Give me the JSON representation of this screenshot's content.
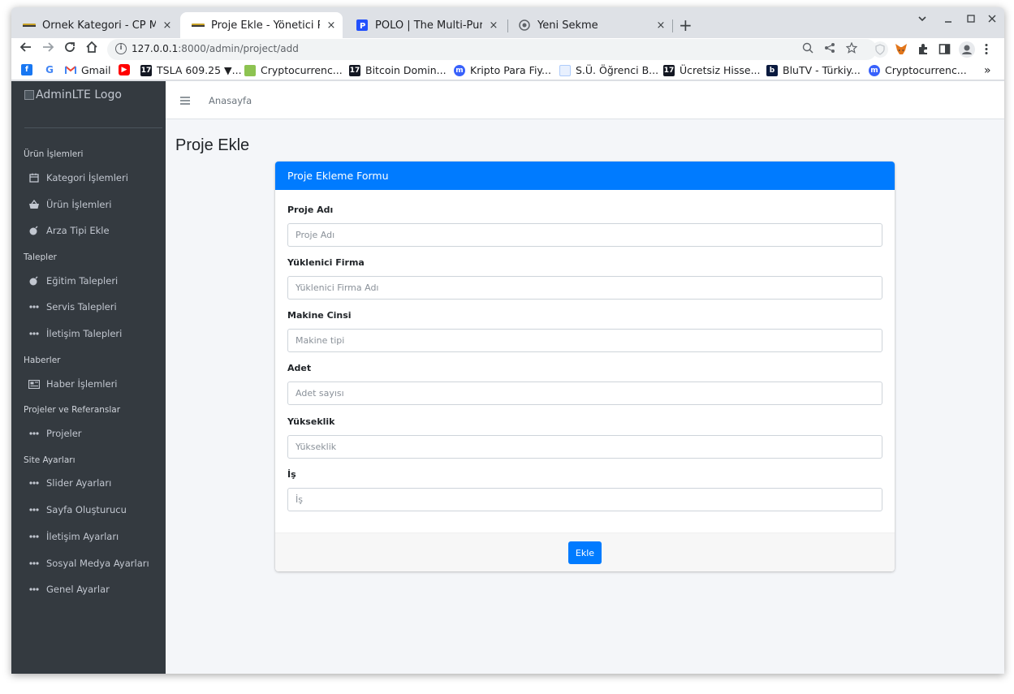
{
  "browser": {
    "tabs": [
      {
        "title": "Örnek Kategori - CP Makin",
        "close": "×"
      },
      {
        "title": "Proje Ekle - Yönetici Panel",
        "close": "×"
      },
      {
        "title": "POLO | The Multi-Purpose",
        "close": "×"
      },
      {
        "title": "Yeni Sekme",
        "close": "×"
      }
    ],
    "url_host": "127.0.0.1",
    "url_rest": ":8000/admin/project/add",
    "bookmarks": [
      "Gmail",
      "TSLA 609.25 ▼...",
      "Cryptocurrenc...",
      "Bitcoin Domin...",
      "Kripto Para Fiy...",
      "S.Ü. Öğrenci B...",
      "Ücretsiz Hisse...",
      "BluTV - Türkiy...",
      "Cryptocurrenc..."
    ],
    "more_bookmarks": "»"
  },
  "sidebar": {
    "brand": "AdminLTE Logo",
    "sections": [
      {
        "header": "Ürün İşlemleri",
        "items": [
          "Kategori İşlemleri",
          "Ürün İşlemleri",
          "Arza Tipi Ekle"
        ]
      },
      {
        "header": "Talepler",
        "items": [
          "Eğitim Talepleri",
          "Servis Talepleri",
          "İletişim Talepleri"
        ]
      },
      {
        "header": "Haberler",
        "items": [
          "Haber İşlemleri"
        ]
      },
      {
        "header": "Projeler ve Referanslar",
        "items": [
          "Projeler"
        ]
      },
      {
        "header": "Site Ayarları",
        "items": [
          "Slider Ayarları",
          "Sayfa Oluşturucu",
          "İletişim Ayarları",
          "Sosyal Medya Ayarları",
          "Genel Ayarlar"
        ]
      }
    ]
  },
  "topnav": {
    "home": "Anasayfa"
  },
  "page": {
    "title": "Proje Ekle"
  },
  "form": {
    "header": "Proje Ekleme Formu",
    "fields": [
      {
        "label": "Proje Adı",
        "placeholder": "Proje Adı"
      },
      {
        "label": "Yüklenici Firma",
        "placeholder": "Yüklenici Firma Adı"
      },
      {
        "label": "Makine Cinsi",
        "placeholder": "Makine tipi"
      },
      {
        "label": "Adet",
        "placeholder": "Adet sayısı"
      },
      {
        "label": "Yükseklik",
        "placeholder": "Yükseklik"
      },
      {
        "label": "İş",
        "placeholder": "İş"
      }
    ],
    "submit": "Ekle"
  },
  "colors": {
    "primary": "#007bff",
    "sidebar": "#343a40",
    "content_bg": "#f4f6f9"
  }
}
